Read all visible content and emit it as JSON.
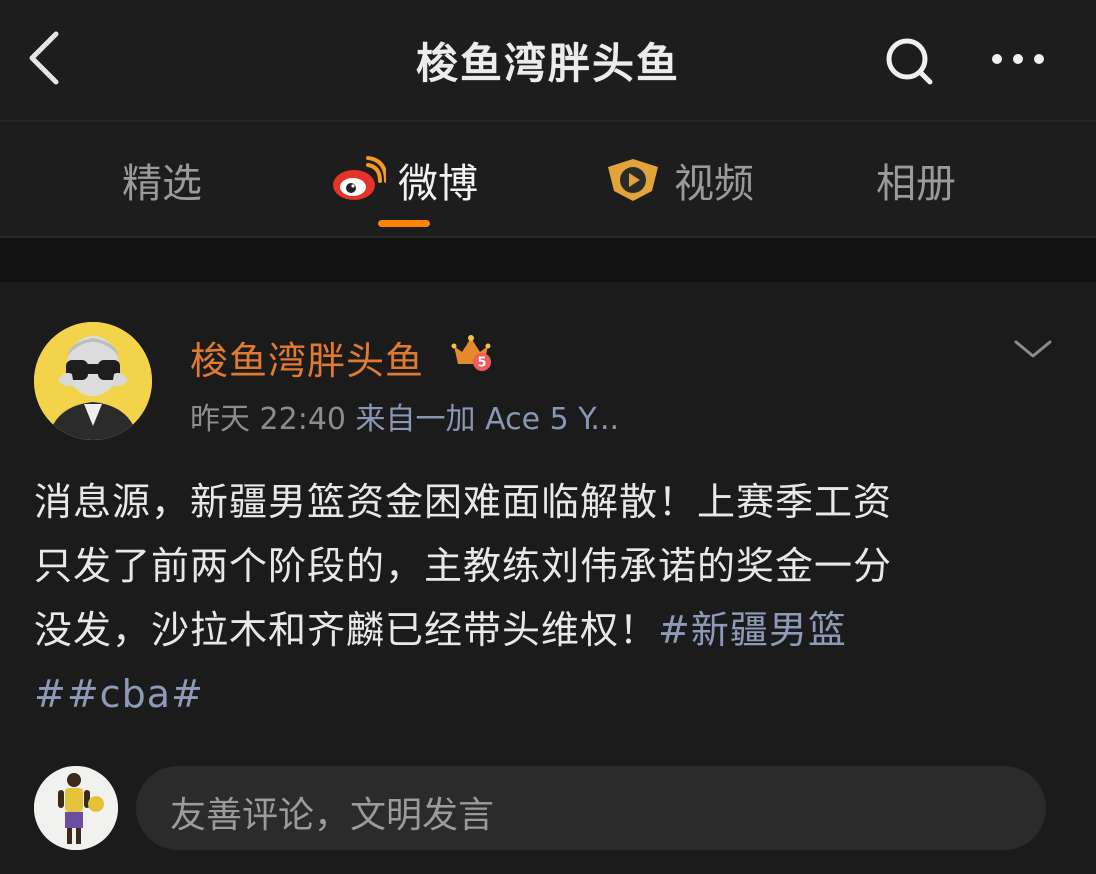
{
  "header": {
    "title": "梭鱼湾胖头鱼"
  },
  "tabs": [
    {
      "label": "精选",
      "active": false
    },
    {
      "label": "微博",
      "active": true,
      "icon": "weibo-logo-icon"
    },
    {
      "label": "视频",
      "active": false,
      "icon": "video-badge-icon"
    },
    {
      "label": "相册",
      "active": false
    }
  ],
  "post": {
    "author": "梭鱼湾胖头鱼",
    "vip_level": "5",
    "time": "昨天 22:40",
    "source": "来自一加 Ace 5 Y...",
    "lines": [
      "消息源，新疆男篮资金困难面临解散！上赛季工资",
      "只发了前两个阶段的，主教练刘伟承诺的奖金一分",
      "没发，沙拉木和齐麟已经带头维权！"
    ],
    "hashtag_1": "#新疆男篮",
    "hashtag_2": "##cba#"
  },
  "comment": {
    "placeholder": "友善评论，文明发言"
  },
  "colors": {
    "accent": "#ff8200",
    "username": "#e07a32",
    "hashtag": "#8d9ab8"
  }
}
